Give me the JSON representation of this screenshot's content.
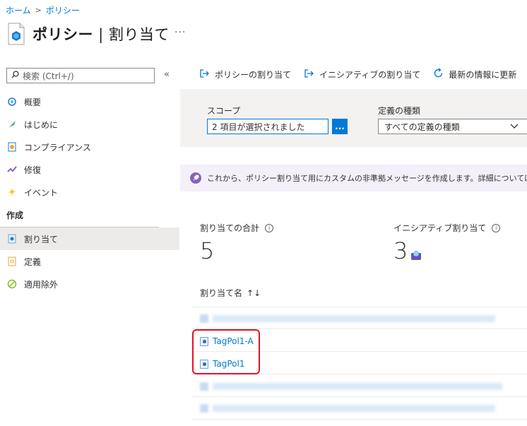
{
  "breadcrumb": {
    "home": "ホーム",
    "separator": ">",
    "current": "ポリシー"
  },
  "header": {
    "title_main": "ポリシー",
    "title_sub": " | 割り当て",
    "more": "···"
  },
  "sidebar": {
    "search_placeholder": "検索 (Ctrl+/)",
    "collapse": "«",
    "items": [
      {
        "label": "概要",
        "icon": "overview-icon"
      },
      {
        "label": "はじめに",
        "icon": "getting-started-icon"
      },
      {
        "label": "コンプライアンス",
        "icon": "compliance-icon"
      },
      {
        "label": "修復",
        "icon": "remediation-icon"
      },
      {
        "label": "イベント",
        "icon": "events-icon"
      }
    ],
    "section": "作成",
    "authoring_items": [
      {
        "label": "割り当て",
        "icon": "assignments-icon",
        "active": true
      },
      {
        "label": "定義",
        "icon": "definitions-icon"
      },
      {
        "label": "適用除外",
        "icon": "exemptions-icon"
      }
    ]
  },
  "toolbar": {
    "assign_policy": "ポリシーの割り当て",
    "assign_initiative": "イニシアティブの割り当て",
    "refresh": "最新の情報に更新"
  },
  "filters": {
    "scope_label": "スコープ",
    "scope_value": "2 項目が選択されました",
    "scope_button": "...",
    "definition_type_label": "定義の種類",
    "definition_type_value": "すべての定義の種類"
  },
  "banner": {
    "text": "これから、ポリシー割り当て用にカスタムの非準拠メッセージを作成します。詳細については、https:/"
  },
  "stats": {
    "total_label": "割り当ての合計",
    "total_value": "5",
    "initiative_label": "イニシアティブ割り当て",
    "initiative_value": "3"
  },
  "table": {
    "column_name": "割り当て名",
    "sort_icon": "↑↓",
    "rows": [
      "TagPol1-A",
      "TagPol1"
    ]
  },
  "colors": {
    "accent": "#0078d4",
    "highlight": "#e81123",
    "banner_bg": "#f4f0f9"
  }
}
